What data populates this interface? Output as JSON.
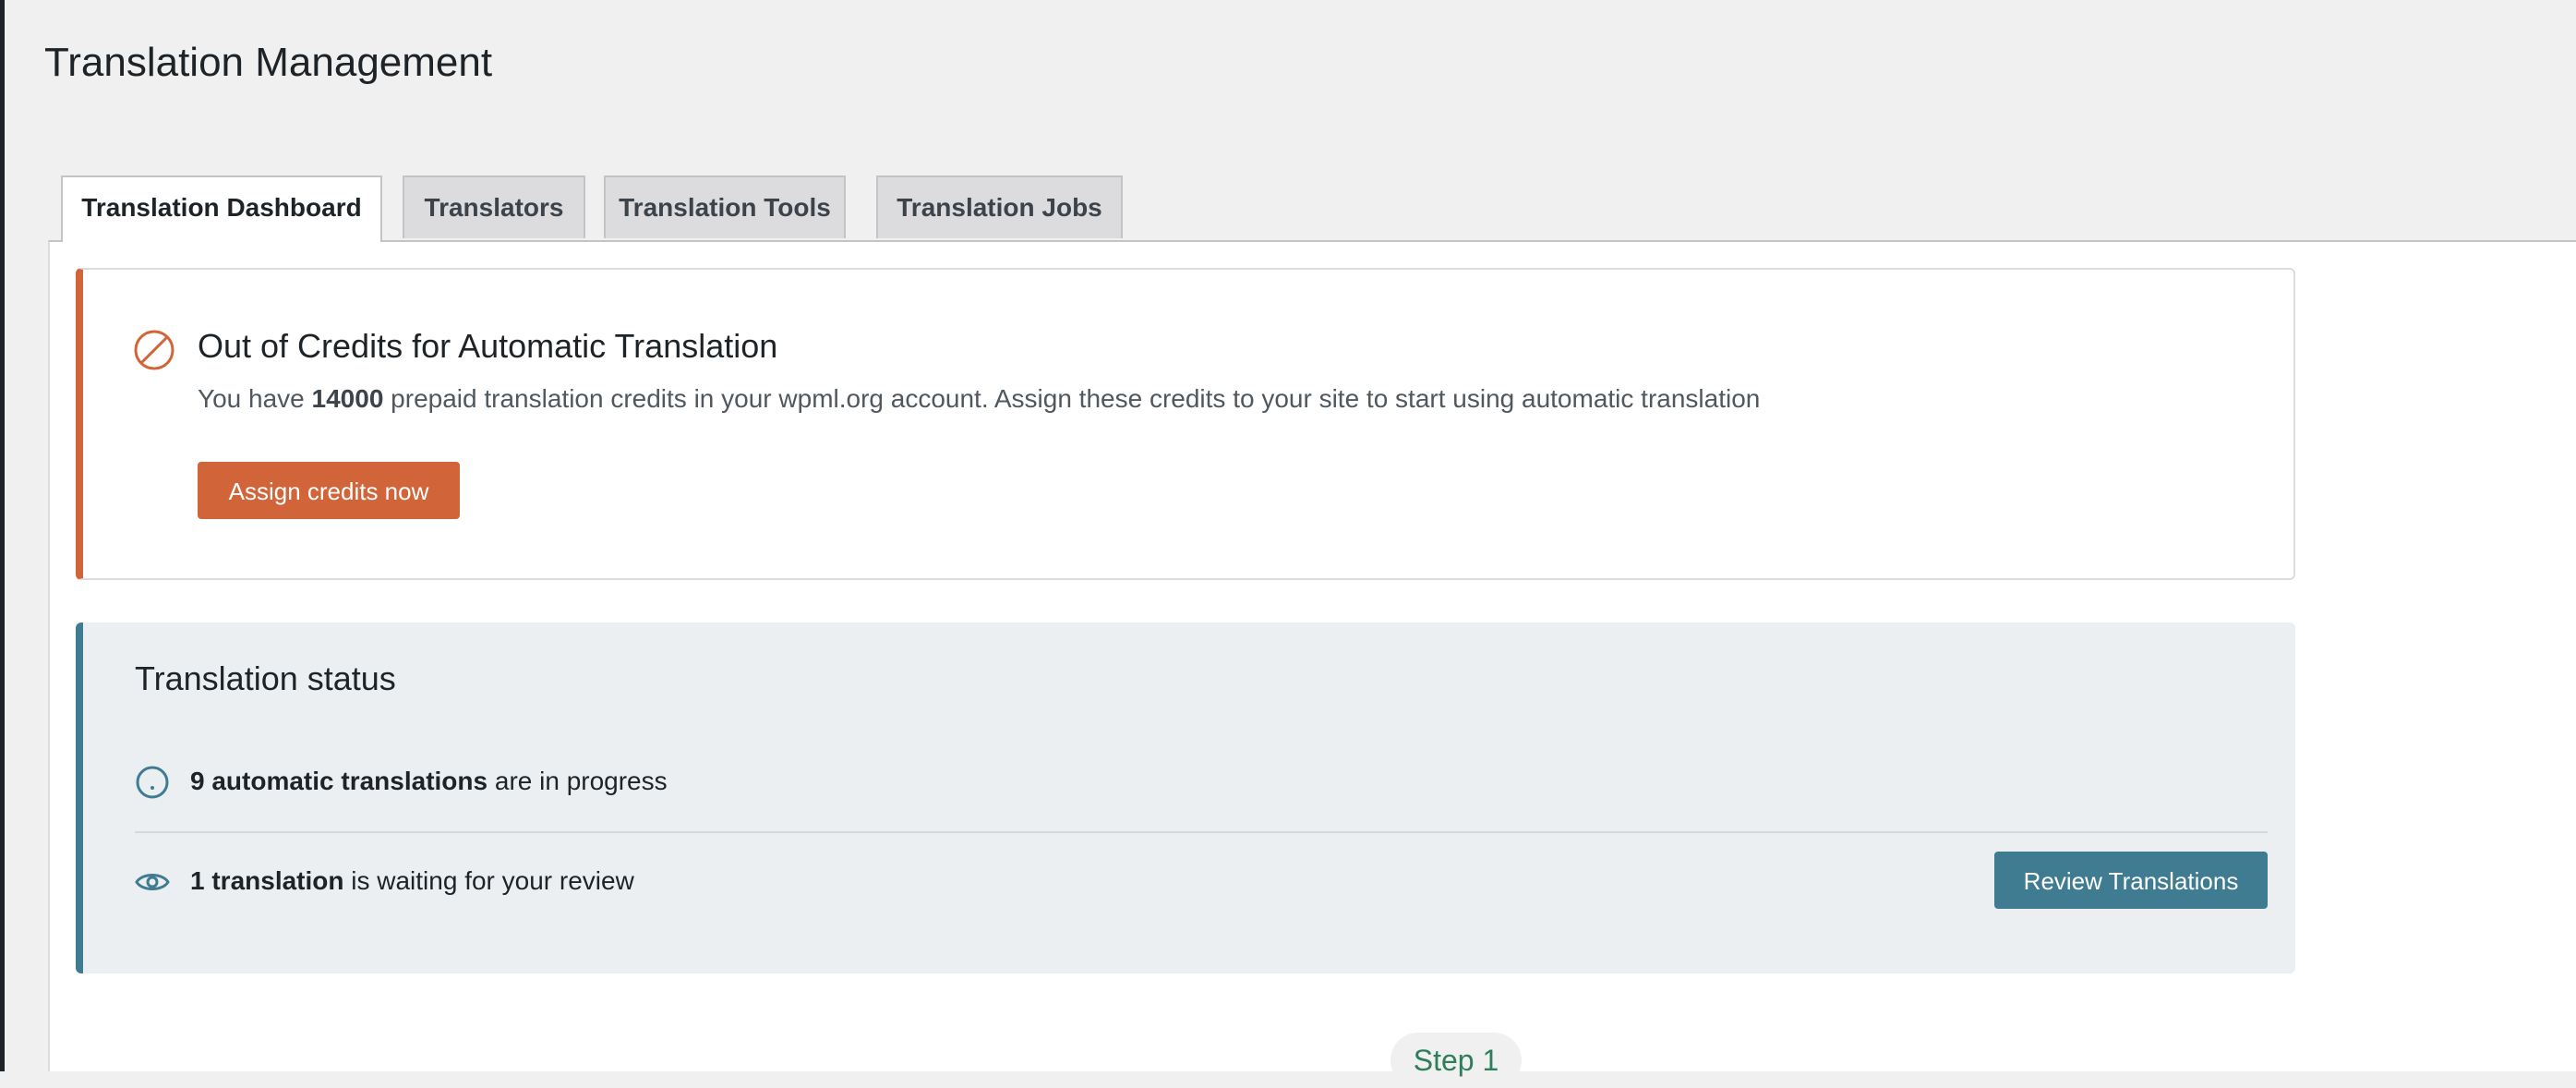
{
  "page": {
    "title": "Translation Management"
  },
  "tabs": [
    {
      "label": "Translation Dashboard",
      "active": true
    },
    {
      "label": "Translators",
      "active": false
    },
    {
      "label": "Translation Tools",
      "active": false
    },
    {
      "label": "Translation Jobs",
      "active": false
    }
  ],
  "notice": {
    "icon": "prohibited-icon",
    "title": "Out of Credits for Automatic Translation",
    "body_prefix": "You have ",
    "credits": "14000",
    "body_suffix": " prepaid translation credits in your wpml.org account. Assign these credits to your site to start using automatic translation",
    "button_label": "Assign credits now",
    "accent_color": "#d2643a"
  },
  "status": {
    "title": "Translation status",
    "accent_color": "#3f7b91",
    "in_progress": {
      "icon": "progress-circle-icon",
      "bold": "9 automatic translations",
      "rest": " are in progress"
    },
    "review": {
      "icon": "eye-icon",
      "bold": "1 translation",
      "rest": " is waiting for your review",
      "button_label": "Review Translations"
    }
  },
  "step": {
    "label": "Step 1"
  }
}
